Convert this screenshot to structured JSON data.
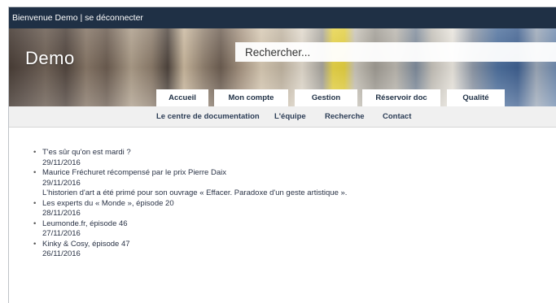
{
  "topbar": {
    "welcome": "Bienvenue Demo",
    "separator": " | ",
    "logout": "se déconnecter"
  },
  "header": {
    "logo": "Demo",
    "search_placeholder": "Rechercher..."
  },
  "tabs": [
    {
      "label": "Accueil"
    },
    {
      "label": "Mon compte"
    },
    {
      "label": "Gestion"
    },
    {
      "label": "Réservoir doc"
    },
    {
      "label": "Qualité"
    }
  ],
  "subnav": [
    {
      "label": "Le centre de documentation"
    },
    {
      "label": "L'équipe"
    },
    {
      "label": "Recherche"
    },
    {
      "label": "Contact"
    }
  ],
  "news": [
    {
      "title": "T'es sûr qu'on est mardi ?",
      "date": "29/11/2016",
      "desc": ""
    },
    {
      "title": "Maurice Fréchuret récompensé par le prix Pierre Daix",
      "date": "29/11/2016",
      "desc": "L'historien d'art a été primé pour son ouvrage « Effacer. Paradoxe d'un geste artistique »."
    },
    {
      "title": "Les experts du « Monde », épisode 20",
      "date": "28/11/2016",
      "desc": ""
    },
    {
      "title": "Leumonde.fr, épisode 46",
      "date": "27/11/2016",
      "desc": ""
    },
    {
      "title": "Kinky & Cosy, épisode 47",
      "date": "26/11/2016",
      "desc": ""
    }
  ],
  "colors": {
    "topbar": "#1f3045",
    "subnav_bg": "#f0f0f0",
    "text": "#2a3346"
  }
}
